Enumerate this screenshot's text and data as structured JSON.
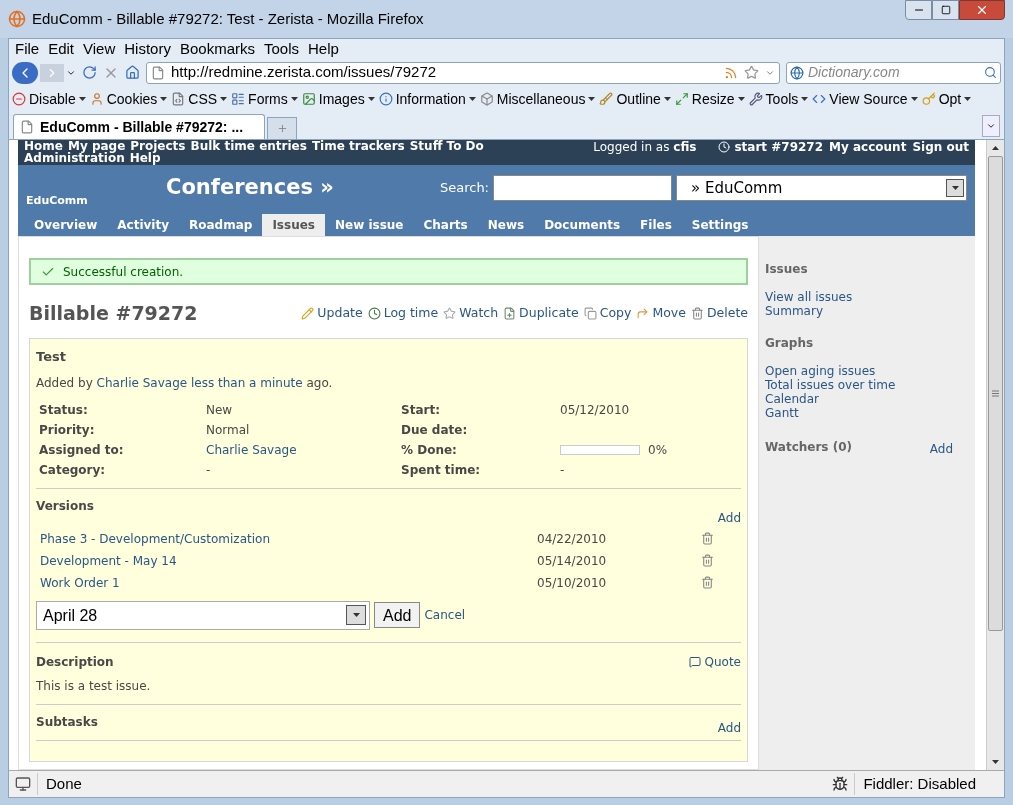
{
  "window": {
    "title": "EduComm - Billable #79272: Test - Zerista - Mozilla Firefox"
  },
  "menu": [
    "File",
    "Edit",
    "View",
    "History",
    "Bookmarks",
    "Tools",
    "Help"
  ],
  "nav": {
    "url": "http://redmine.zerista.com/issues/79272",
    "search_placeholder": "Dictionary.com"
  },
  "toolbar": [
    "Disable",
    "Cookies",
    "CSS",
    "Forms",
    "Images",
    "Information",
    "Miscellaneous",
    "Outline",
    "Resize",
    "Tools",
    "View Source",
    "Opt"
  ],
  "browser_tabs": [
    {
      "label": "EduComm - Billable #79272: ...",
      "selected": true
    }
  ],
  "top_menu": {
    "items": [
      "Home",
      "My page",
      "Projects",
      "Bulk time entries",
      "Time trackers",
      "Stuff To Do",
      "Administration",
      "Help"
    ],
    "logged_in_label": "Logged in as",
    "user": "cfis",
    "timer": "start #79272",
    "right": [
      "My account",
      "Sign out"
    ]
  },
  "header": {
    "project_name": "EduComm",
    "title": "Conferences »",
    "search_label": "Search:",
    "jump_select": "» EduComm"
  },
  "project_tabs": [
    {
      "label": "Overview",
      "selected": false
    },
    {
      "label": "Activity",
      "selected": false
    },
    {
      "label": "Roadmap",
      "selected": false
    },
    {
      "label": "Issues",
      "selected": true
    },
    {
      "label": "New issue",
      "selected": false
    },
    {
      "label": "Charts",
      "selected": false
    },
    {
      "label": "News",
      "selected": false
    },
    {
      "label": "Documents",
      "selected": false
    },
    {
      "label": "Files",
      "selected": false
    },
    {
      "label": "Settings",
      "selected": false
    }
  ],
  "flash": "Successful creation.",
  "issue": {
    "title": "Billable #79272",
    "actions": [
      "Update",
      "Log time",
      "Watch",
      "Duplicate",
      "Copy",
      "Move",
      "Delete"
    ],
    "subject": "Test",
    "added_by": {
      "prefix": "Added by",
      "author": "Charlie Savage",
      "age": "less than a minute",
      "suffix": "ago."
    },
    "attributes_left": [
      {
        "label": "Status:",
        "value": "New",
        "kind": "text"
      },
      {
        "label": "Priority:",
        "value": "Normal",
        "kind": "text"
      },
      {
        "label": "Assigned to:",
        "value": "Charlie Savage",
        "kind": "link"
      },
      {
        "label": "Category:",
        "value": "-",
        "kind": "text"
      }
    ],
    "attributes_right": [
      {
        "label": "Start:",
        "value": "05/12/2010",
        "kind": "text"
      },
      {
        "label": "Due date:",
        "kind": "empty"
      },
      {
        "label": "% Done:",
        "kind": "progress",
        "level": 0,
        "reading": "0%"
      },
      {
        "label": "Spent time:",
        "value": "-",
        "kind": "text"
      }
    ],
    "versions": {
      "heading": "Versions",
      "add": "Add",
      "rows": [
        {
          "name": "Phase 3 - Development/Customization",
          "date": "04/22/2010"
        },
        {
          "name": "Development - May 14",
          "date": "05/14/2010"
        },
        {
          "name": "Work Order 1",
          "date": "05/10/2010"
        }
      ],
      "select_value": "April 28",
      "add_button": "Add",
      "cancel": "Cancel"
    },
    "description": {
      "heading": "Description",
      "quote": "Quote",
      "text": "This is a test issue."
    },
    "subtasks": {
      "heading": "Subtasks",
      "add": "Add"
    }
  },
  "sidebar": {
    "sections": [
      {
        "heading": "Issues",
        "links": [
          "View all issues",
          "Summary"
        ]
      },
      {
        "heading": "Graphs",
        "links": [
          "Open aging issues",
          "Total issues over time",
          "Calendar",
          "Gantt"
        ]
      }
    ],
    "watchers": {
      "heading": "Watchers (0)",
      "add": "Add"
    }
  },
  "status_bar": {
    "text": "Done",
    "addon": "Fiddler: Disabled"
  }
}
